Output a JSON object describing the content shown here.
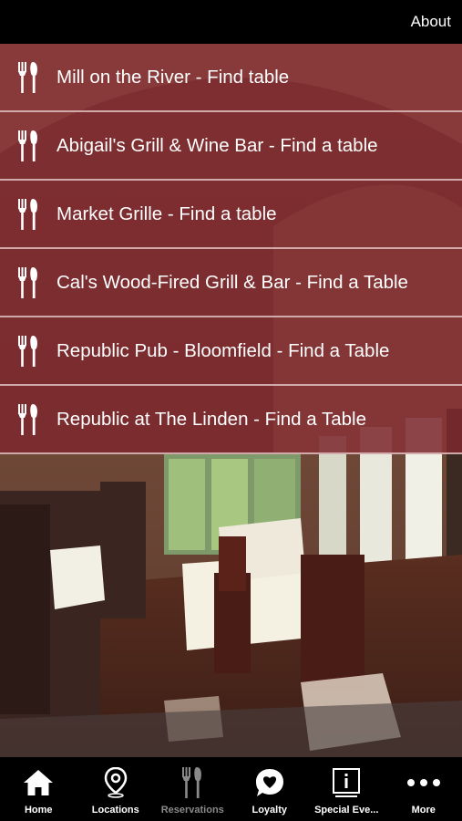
{
  "header": {
    "about_label": "About"
  },
  "restaurants": [
    {
      "label": "Mill on the River - Find table",
      "icon": "fork-knife-icon"
    },
    {
      "label": "Abigail's Grill & Wine Bar - Find a table",
      "icon": "fork-knife-icon"
    },
    {
      "label": "Market Grille - Find a table",
      "icon": "fork-knife-icon"
    },
    {
      "label": "Cal's Wood-Fired Grill & Bar - Find a Table",
      "icon": "fork-knife-icon"
    },
    {
      "label": "Republic Pub - Bloomfield - Find a Table",
      "icon": "fork-knife-icon"
    },
    {
      "label": "Republic at The Linden - Find a Table",
      "icon": "fork-knife-icon"
    }
  ],
  "tabs": [
    {
      "label": "Home",
      "icon": "home-icon",
      "active": false
    },
    {
      "label": "Locations",
      "icon": "location-pin-icon",
      "active": false
    },
    {
      "label": "Reservations",
      "icon": "fork-knife-icon",
      "active": true
    },
    {
      "label": "Loyalty",
      "icon": "heart-bubble-icon",
      "active": false
    },
    {
      "label": "Special Eve...",
      "icon": "info-board-icon",
      "active": false
    },
    {
      "label": "More",
      "icon": "more-dots-icon",
      "active": false
    }
  ],
  "colors": {
    "row_overlay": "#7d282d",
    "row_divider": "#e1bebe",
    "active_tab_label": "#8a8a8a"
  }
}
